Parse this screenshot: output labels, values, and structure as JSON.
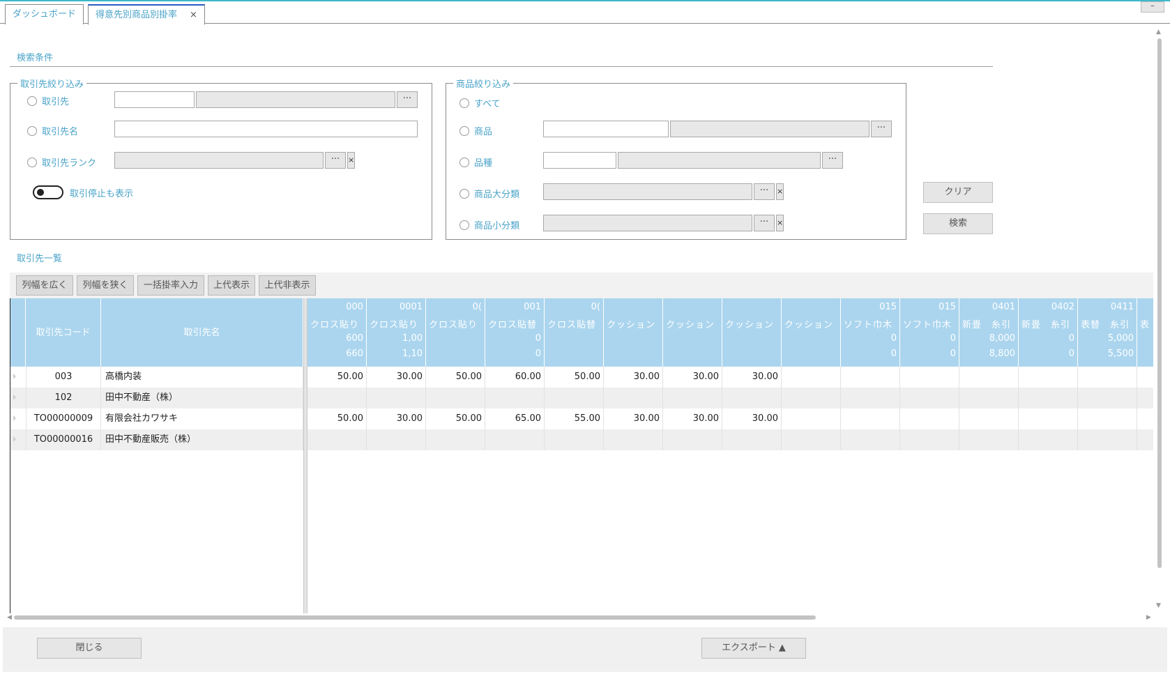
{
  "tabs": [
    {
      "label": "ダッシュボード"
    },
    {
      "label": "得意先別商品別掛率",
      "close": "×"
    }
  ],
  "window": {
    "minimize": "–"
  },
  "search": {
    "title": "検索条件",
    "customer_group": {
      "legend": "取引先絞り込み",
      "customer_label": "取引先",
      "customer_name_label": "取引先名",
      "customer_rank_label": "取引先ランク",
      "show_suspended_label": "取引停止も表示"
    },
    "product_group": {
      "legend": "商品絞り込み",
      "all_label": "すべて",
      "product_label": "商品",
      "variety_label": "品種",
      "major_label": "商品大分類",
      "minor_label": "商品小分類"
    },
    "dots": "···",
    "x": "×",
    "clear_label": "クリア",
    "search_label": "検索"
  },
  "list": {
    "title": "取引先一覧",
    "toolbar": [
      "列幅を広く",
      "列幅を狭く",
      "一括掛率入力",
      "上代表示",
      "上代非表示"
    ],
    "frozen_headers": [
      "取引先コード",
      "取引先名"
    ],
    "columns": [
      {
        "code": "000",
        "name": "クロス貼り",
        "p1": "600",
        "p2": "660"
      },
      {
        "code": "0001",
        "name": "クロス貼り",
        "p1": "1,00",
        "p2": "1,10"
      },
      {
        "code": "0(",
        "name": "クロス貼り",
        "p1": "",
        "p2": ""
      },
      {
        "code": "001",
        "name": "クロス貼替",
        "p1": "0",
        "p2": "0"
      },
      {
        "code": "0(",
        "name": "クロス貼替",
        "p1": "",
        "p2": ""
      },
      {
        "code": "",
        "name": "クッション",
        "p1": "",
        "p2": ""
      },
      {
        "code": "",
        "name": "クッション",
        "p1": "",
        "p2": ""
      },
      {
        "code": "",
        "name": "クッション",
        "p1": "",
        "p2": ""
      },
      {
        "code": "",
        "name": "クッション",
        "p1": "",
        "p2": ""
      },
      {
        "code": "015",
        "name": "ソフト巾木",
        "p1": "0",
        "p2": "0"
      },
      {
        "code": "015",
        "name": "ソフト巾木",
        "p1": "0",
        "p2": "0"
      },
      {
        "code": "0401",
        "name": "新畳　糸引",
        "p1": "8,000",
        "p2": "8,800"
      },
      {
        "code": "0402",
        "name": "新畳　糸引",
        "p1": "0",
        "p2": "0"
      },
      {
        "code": "0411",
        "name": "表替　糸引",
        "p1": "5,000",
        "p2": "5,500"
      },
      {
        "code": "",
        "name": "表",
        "p1": "",
        "p2": ""
      }
    ],
    "rows": [
      {
        "code": "003",
        "name": "高橋内装",
        "values": [
          "50.00",
          "30.00",
          "50.00",
          "60.00",
          "50.00",
          "30.00",
          "30.00",
          "30.00",
          "",
          "",
          "",
          "",
          "",
          "",
          ""
        ]
      },
      {
        "code": "102",
        "name": "田中不動産（株）",
        "values": [
          "",
          "",
          "",
          "",
          "",
          "",
          "",
          "",
          "",
          "",
          "",
          "",
          "",
          "",
          ""
        ]
      },
      {
        "code": "TO00000009",
        "name": "有限会社カワサキ",
        "values": [
          "50.00",
          "30.00",
          "50.00",
          "65.00",
          "55.00",
          "30.00",
          "30.00",
          "30.00",
          "",
          "",
          "",
          "",
          "",
          "",
          ""
        ]
      },
      {
        "code": "TO00000016",
        "name": "田中不動産販売（株）",
        "values": [
          "",
          "",
          "",
          "",
          "",
          "",
          "",
          "",
          "",
          "",
          "",
          "",
          "",
          "",
          ""
        ]
      }
    ]
  },
  "footer": {
    "close_label": "閉じる",
    "export_label": "エクスポート ▲"
  }
}
